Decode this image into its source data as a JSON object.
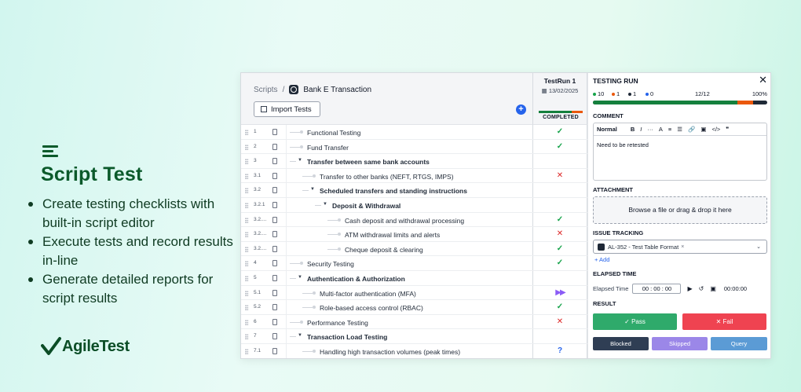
{
  "hero": {
    "title": "Script Test",
    "bullets": [
      "Create testing checklists with built-in script editor",
      "Execute tests and record results in-line",
      "Generate detailed reports for script results"
    ],
    "brand": "AgileTest"
  },
  "breadcrumb": {
    "root": "Scripts",
    "separator": "/",
    "current": "Bank E Transaction"
  },
  "toolbar": {
    "import_label": "Import Tests",
    "add_label": "+"
  },
  "test_run": {
    "name": "TestRun 1",
    "date": "13/02/2025",
    "status": "COMPLETED"
  },
  "rows": [
    {
      "num": "1",
      "label": "Functional Testing",
      "result": "✓",
      "status": "pass"
    },
    {
      "num": "2",
      "label": "Fund Transfer",
      "result": "✓",
      "status": "pass"
    },
    {
      "num": "3",
      "label": "Transfer between same bank accounts",
      "result": "",
      "status": ""
    },
    {
      "num": "3.1",
      "label": "Transfer to other banks (NEFT, RTGS, IMPS)",
      "result": "✕",
      "status": "fail"
    },
    {
      "num": "3.2",
      "label": "Scheduled transfers and standing instructions",
      "result": "",
      "status": ""
    },
    {
      "num": "3.2.1",
      "label": "Deposit & Withdrawal",
      "result": "",
      "status": ""
    },
    {
      "num": "3.2....",
      "label": "Cash deposit and withdrawal processing",
      "result": "✓",
      "status": "pass"
    },
    {
      "num": "3.2....",
      "label": "ATM withdrawal limits and alerts",
      "result": "✕",
      "status": "fail"
    },
    {
      "num": "3.2....",
      "label": "Cheque deposit & clearing",
      "result": "✓",
      "status": "pass"
    },
    {
      "num": "4",
      "label": "Security Testing",
      "result": "✓",
      "status": "pass"
    },
    {
      "num": "5",
      "label": "Authentication & Authorization",
      "result": "",
      "status": ""
    },
    {
      "num": "5.1",
      "label": "Multi-factor authentication (MFA)",
      "result": "▶▶",
      "status": "skip"
    },
    {
      "num": "5.2",
      "label": "Role-based access control (RBAC)",
      "result": "✓",
      "status": "pass"
    },
    {
      "num": "6",
      "label": "Performance Testing",
      "result": "✕",
      "status": "fail"
    },
    {
      "num": "7",
      "label": "Transaction Load Testing",
      "result": "",
      "status": ""
    },
    {
      "num": "7.1",
      "label": "Handling high transaction volumes (peak times)",
      "result": "?",
      "status": "query"
    }
  ],
  "side": {
    "title": "TESTING RUN",
    "close": "✕",
    "stats": {
      "pass": "10",
      "fail": "1",
      "skip": "1",
      "query": "0",
      "count": "12/12",
      "percent": "100%"
    },
    "progress": {
      "pass": 0.83,
      "fail": 0.09,
      "other": 0.08
    },
    "comment_label": "COMMENT",
    "editor_tools": [
      "Normal",
      "B",
      "I",
      "···",
      "A",
      "≡",
      "☰",
      "🔗",
      "▣",
      "</>",
      "❞"
    ],
    "comment_text": "Need to be retested",
    "attachment_label": "ATTACHMENT",
    "dropzone_text": "Browse a file or drag & drop it here",
    "issue_label": "ISSUE TRACKING",
    "issue_value": "AL-352 - Test Table Format",
    "issue_remove": "×",
    "add_label": "+ Add",
    "elapsed_label": "ELAPSED TIME",
    "elapsed_field_label": "Elapsed Time",
    "elapsed_input": "00 : 00 : 00",
    "elapsed_value": "00:00:00",
    "result_label": "RESULT",
    "pass_label": "✓  Pass",
    "fail_label": "✕  Fail",
    "blocked_label": "Blocked",
    "skipped_label": "Skipped",
    "query_label": "Query"
  },
  "colors": {
    "brand_green": "#0b5a2b",
    "pass": "#2faa6b",
    "fail": "#ef4351",
    "blocked": "#2f3e54",
    "skipped": "#9b87e8",
    "query": "#5b9bd5",
    "accent_blue": "#2563eb"
  }
}
